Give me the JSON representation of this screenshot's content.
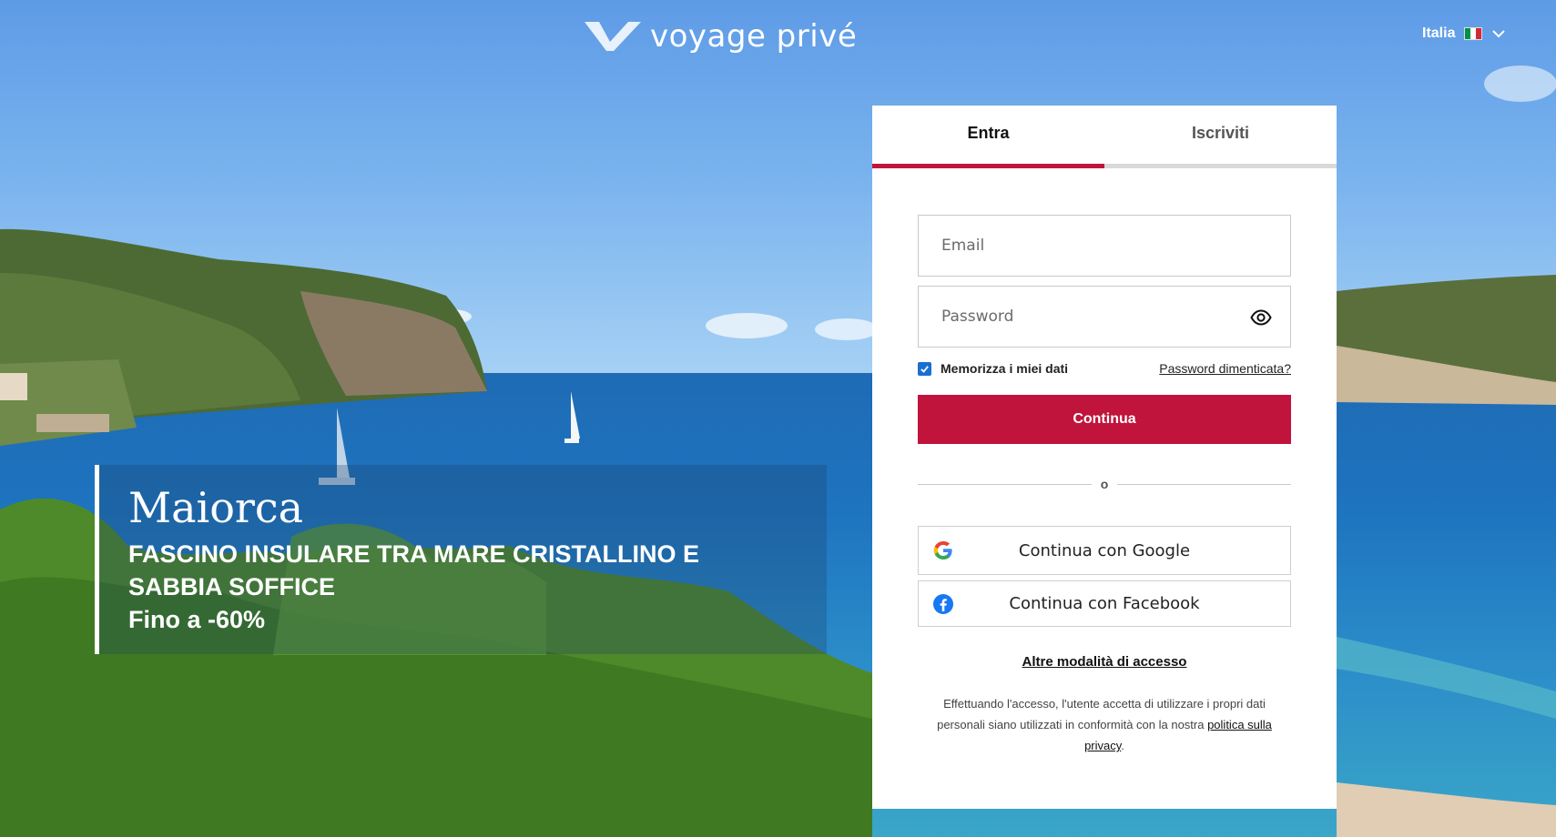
{
  "header": {
    "logo_text": "voyage privé",
    "country_label": "Italia"
  },
  "promo": {
    "title": "Maiorca",
    "subtitle": "FASCINO INSULARE TRA MARE CRISTALLINO E SABBIA SOFFICE",
    "discount": "Fino a -60%"
  },
  "login": {
    "tabs": [
      {
        "label": "Entra",
        "active": true
      },
      {
        "label": "Iscriviti",
        "active": false
      }
    ],
    "email_placeholder": "Email",
    "password_placeholder": "Password",
    "remember_label": "Memorizza i miei dati",
    "remember_checked": true,
    "forgot_label": "Password dimenticata?",
    "continue_label": "Continua",
    "or_label": "o",
    "google_label": "Continua con Google",
    "facebook_label": "Continua con Facebook",
    "more_label": "Altre modalità di accesso",
    "legal_text": "Effettuando l'accesso, l'utente accetta di utilizzare i propri dati personali siano utilizzati in conformità con la nostra ",
    "legal_link": "politica sulla privacy",
    "legal_end": "."
  },
  "colors": {
    "accent": "#c0143c",
    "checkbox": "#1a6fd1"
  }
}
